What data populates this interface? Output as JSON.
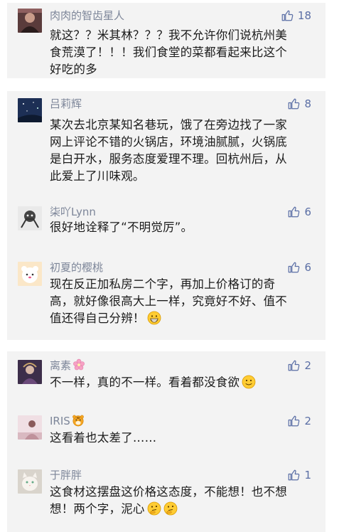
{
  "colors": {
    "block_bg": "#f3f3f3",
    "name_color": "#7d8699",
    "like_color": "#5a6ea5",
    "text_color": "#1b1b1b"
  },
  "comments": [
    {
      "user": "肉肉的智齿星人",
      "likes": "18",
      "lines": [
        "就这？？米其林？？？我不允许你们说杭州美",
        "食荒漠了！！！我们食堂的菜都看起来比这个",
        "好吃的多"
      ]
    },
    {
      "user": "吕莉辉",
      "likes": "8",
      "lines": [
        "某次去北京某知名巷玩，饿了在旁边找了一家",
        "网上评论不错的火锅店，环境油腻腻，火锅底",
        "是白开水，服务态度爱理不理。回杭州后，从",
        "此爱上了川味观。"
      ]
    },
    {
      "user": "柒吖Lynn",
      "likes": "6",
      "lines": [
        "很好地诠释了“不明觉厉”。"
      ]
    },
    {
      "user": "初夏的樱桃",
      "likes": "6",
      "lines": [
        "现在反正加私房二个字，再加上价格订的奇",
        "高，就好像很高大上一样，究竟好不好、值不",
        "值还得自己分辨！"
      ],
      "trailing_emoji": "grin-emoji"
    },
    {
      "user": "离素",
      "user_emoji": "cherry-blossom-emoji",
      "likes": "2",
      "lines": [
        "不一样，真的不一样。看着都没食欲"
      ],
      "trailing_emoji": "slight-smile-emoji"
    },
    {
      "user": "IRIS",
      "user_emoji": "tiger-emoji",
      "likes": "2",
      "lines": [
        "这看着也太差了……"
      ]
    },
    {
      "user": "于胖胖",
      "likes": "1",
      "lines": [
        "这食材这摆盘这价格这态度，不能想！也不想",
        "想！两个字，泥心"
      ],
      "trailing_emoji": "thinking-emoji-x2"
    }
  ]
}
